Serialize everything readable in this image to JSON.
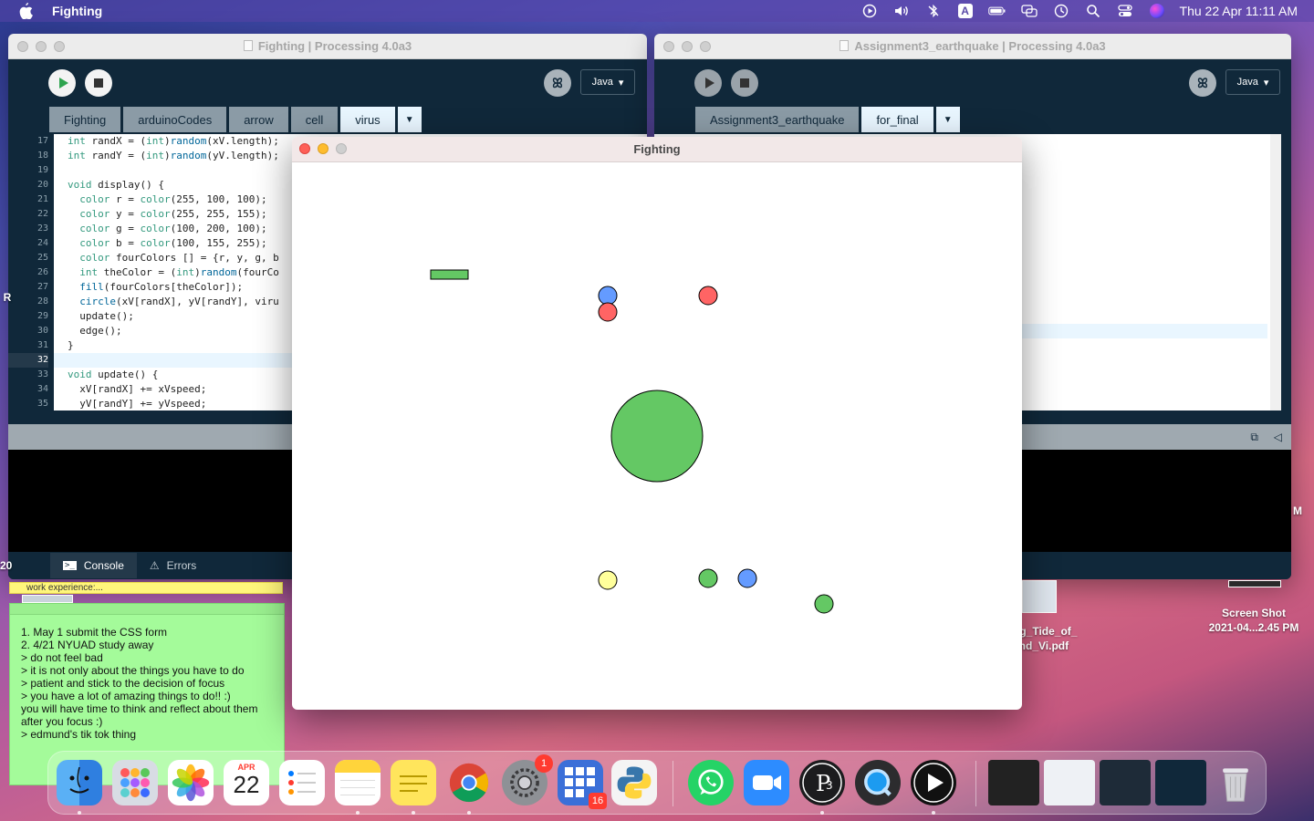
{
  "menubar": {
    "app_name": "Fighting",
    "clock": "Thu 22 Apr  11:11 AM",
    "icons": [
      "play-circle-icon",
      "volume-icon",
      "bluetooth-icon",
      "input-source-icon",
      "battery-icon",
      "screen-mirroring-icon",
      "time-machine-icon",
      "spotlight-icon",
      "control-center-icon",
      "siri-icon"
    ],
    "input_source_letter": "A"
  },
  "left_window": {
    "title": "Fighting | Processing 4.0a3",
    "mode_label": "Java",
    "tabs": [
      "Fighting",
      "arduinoCodes",
      "arrow",
      "cell",
      "virus"
    ],
    "active_tab": "virus",
    "line_numbers": [
      "17",
      "18",
      "19",
      "20",
      "21",
      "22",
      "23",
      "24",
      "25",
      "26",
      "27",
      "28",
      "29",
      "30",
      "31",
      "32",
      "33",
      "34",
      "35"
    ],
    "code_lines": [
      "int randX = (int)random(xV.length);",
      "int randY = (int)random(yV.length);",
      "",
      "void display() {",
      "  color r = color(255, 100, 100);",
      "  color y = color(255, 255, 155);",
      "  color g = color(100, 200, 100);",
      "  color b = color(100, 155, 255);",
      "  color fourColors [] = {r, y, g, b",
      "  int theColor = (int)random(fourCo",
      "  fill(fourColors[theColor]);",
      "  circle(xV[randX], yV[randY], viru",
      "  update();",
      "  edge();",
      "}",
      "",
      "void update() {",
      "  xV[randX] += xVspeed;",
      "  yV[randY] += yVspeed;"
    ],
    "console_label": "Console",
    "errors_label": "Errors"
  },
  "right_window": {
    "title": "Assignment3_earthquake | Processing 4.0a3",
    "mode_label": "Java",
    "tabs": [
      "Assignment3_earthquake",
      "for_final"
    ],
    "active_tab": "for_final"
  },
  "sketch": {
    "title": "Fighting"
  },
  "stickies": {
    "yellow_title": "work experience:...",
    "green_lines": [
      "1. May 1 submit the CSS form",
      "2. 4/21 NYUAD study away",
      "> do not feel bad",
      "> it is not only about the things you have to do",
      "> patient and stick to the decision of focus",
      "> you have a lot of amazing things to do!! :)",
      "you will have time to think and reflect about them after you focus :)",
      "> edmund's tik tok thing"
    ]
  },
  "desktop": {
    "file1_label": "ng_Tide_of_\nand_Vi.pdf",
    "file2_label": "Screen Shot\n2021-04...2.45 PM",
    "edge_r": "R",
    "edge_m": "M",
    "edge_20": "20"
  },
  "dock": {
    "calendar_month": "APR",
    "calendar_day": "22",
    "system_prefs_badge": "1",
    "app_grid_badge": "16",
    "apps": [
      "finder-icon",
      "launchpad-icon",
      "photos-icon",
      "calendar-icon",
      "reminders-icon",
      "notes-icon",
      "stickies-icon",
      "chrome-icon",
      "system-preferences-icon",
      "app-grid-icon",
      "python-icon",
      "whatsapp-icon",
      "zoom-icon",
      "processing-icon",
      "quicktime-icon",
      "sketch-play-icon",
      "trash-icon"
    ]
  }
}
